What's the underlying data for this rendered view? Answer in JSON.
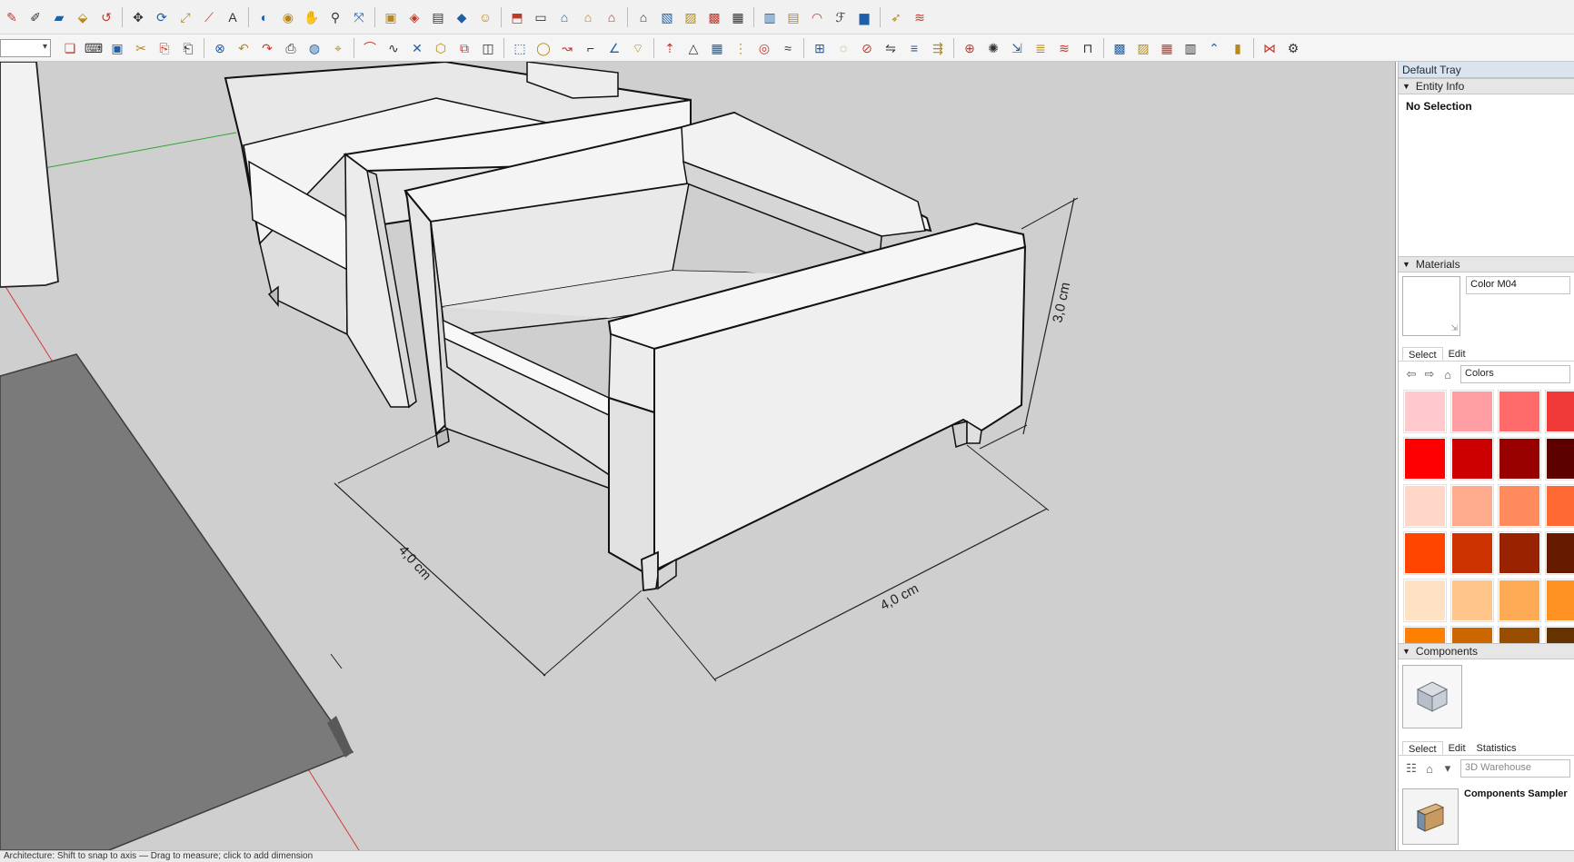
{
  "tray": {
    "title": "Default Tray",
    "entity_info": {
      "header": "Entity Info",
      "selection": "No Selection"
    },
    "materials": {
      "header": "Materials",
      "current_material": "Color M04",
      "tabs": [
        "Select",
        "Edit"
      ],
      "library": "Colors",
      "swatch_colors": [
        "#ffc9cd",
        "#ff9ea3",
        "#ff6b6b",
        "#f03a3a",
        "#ff0000",
        "#cc0000",
        "#990000",
        "#5c0000",
        "#ffd6c8",
        "#ffab8d",
        "#ff8a5c",
        "#ff6a32",
        "#ff4500",
        "#cc3300",
        "#992200",
        "#661a00",
        "#ffe1c4",
        "#ffc58b",
        "#ffab55",
        "#ff9122",
        "#ff8000",
        "#cc6600",
        "#994d00",
        "#663300"
      ]
    },
    "components": {
      "header": "Components",
      "tabs": [
        "Select",
        "Edit",
        "Statistics"
      ],
      "search_placeholder": "3D Warehouse",
      "sampler_title": "Components Sampler"
    }
  },
  "viewport": {
    "dimensions": {
      "height_label": "3,0 cm",
      "depth_label": "4,0 cm",
      "width_label": "4,0 cm"
    }
  },
  "colors": {
    "viewport_bg": "#cfcfcf",
    "sofa_light": "#eeeeee",
    "sofa_shade": "#dcdcdc",
    "sofa_dark": "#c9c9c9",
    "mat": "#7a7a7a",
    "axis_red": "#d23a3a",
    "axis_green": "#2fa52f"
  },
  "icons": {
    "row1": [
      "eraser-icon",
      "line-icon",
      "paint-icon",
      "pushpull-icon",
      "followme-icon",
      "move-icon",
      "rotate-icon",
      "scale-icon",
      "tape-icon",
      "text-icon",
      "paintbucket-icon",
      "orbit-icon",
      "pan-icon",
      "zoom-icon",
      "zoom-extents-icon",
      "warehouse-icon",
      "extension-icon",
      "model-info-icon",
      "ruby-icon",
      "account-icon",
      "iso-view-icon",
      "top-view-icon",
      "front-view-icon",
      "right-view-icon",
      "back-view-icon",
      "left-view-icon",
      "xray-icon",
      "wireframe-icon",
      "hidden-line-icon",
      "shaded-icon",
      "textured-icon",
      "monochrome-icon",
      "section-icon",
      "style-icon",
      "color-gradient-icon",
      "cursor-icon",
      "stairs-icon"
    ],
    "row2": [
      "new-icon",
      "open-icon",
      "save-icon",
      "cut-icon",
      "copy-icon",
      "paste-icon",
      "delete-icon",
      "undo-icon",
      "redo-icon",
      "print-icon",
      "model-icon",
      "select-icon",
      "arc-icon",
      "curve-icon",
      "knife-icon",
      "polygon-icon",
      "offset-icon",
      "sandbox-icon",
      "box-icon",
      "sphere-icon",
      "bend-icon",
      "corner-icon",
      "angle-icon",
      "fillet-icon",
      "extrude-icon",
      "cone-icon",
      "grid-icon",
      "array-icon",
      "lathe-icon",
      "loft-icon",
      "skin-icon",
      "shell-icon",
      "split-icon",
      "mirror-icon",
      "align-icon",
      "distribute-icon",
      "weld-icon",
      "explode-icon",
      "project-icon",
      "stack-icon",
      "stairs-icon",
      "railing-icon",
      "pattern-icon",
      "hatch-icon",
      "tile-icon",
      "texture-icon",
      "roof-icon",
      "wall-icon",
      "truss-icon",
      "settings-icon"
    ]
  },
  "statusbar": {
    "hint": "Architecture: Shift to snap to axis — Drag to measure; click to add dimension"
  }
}
